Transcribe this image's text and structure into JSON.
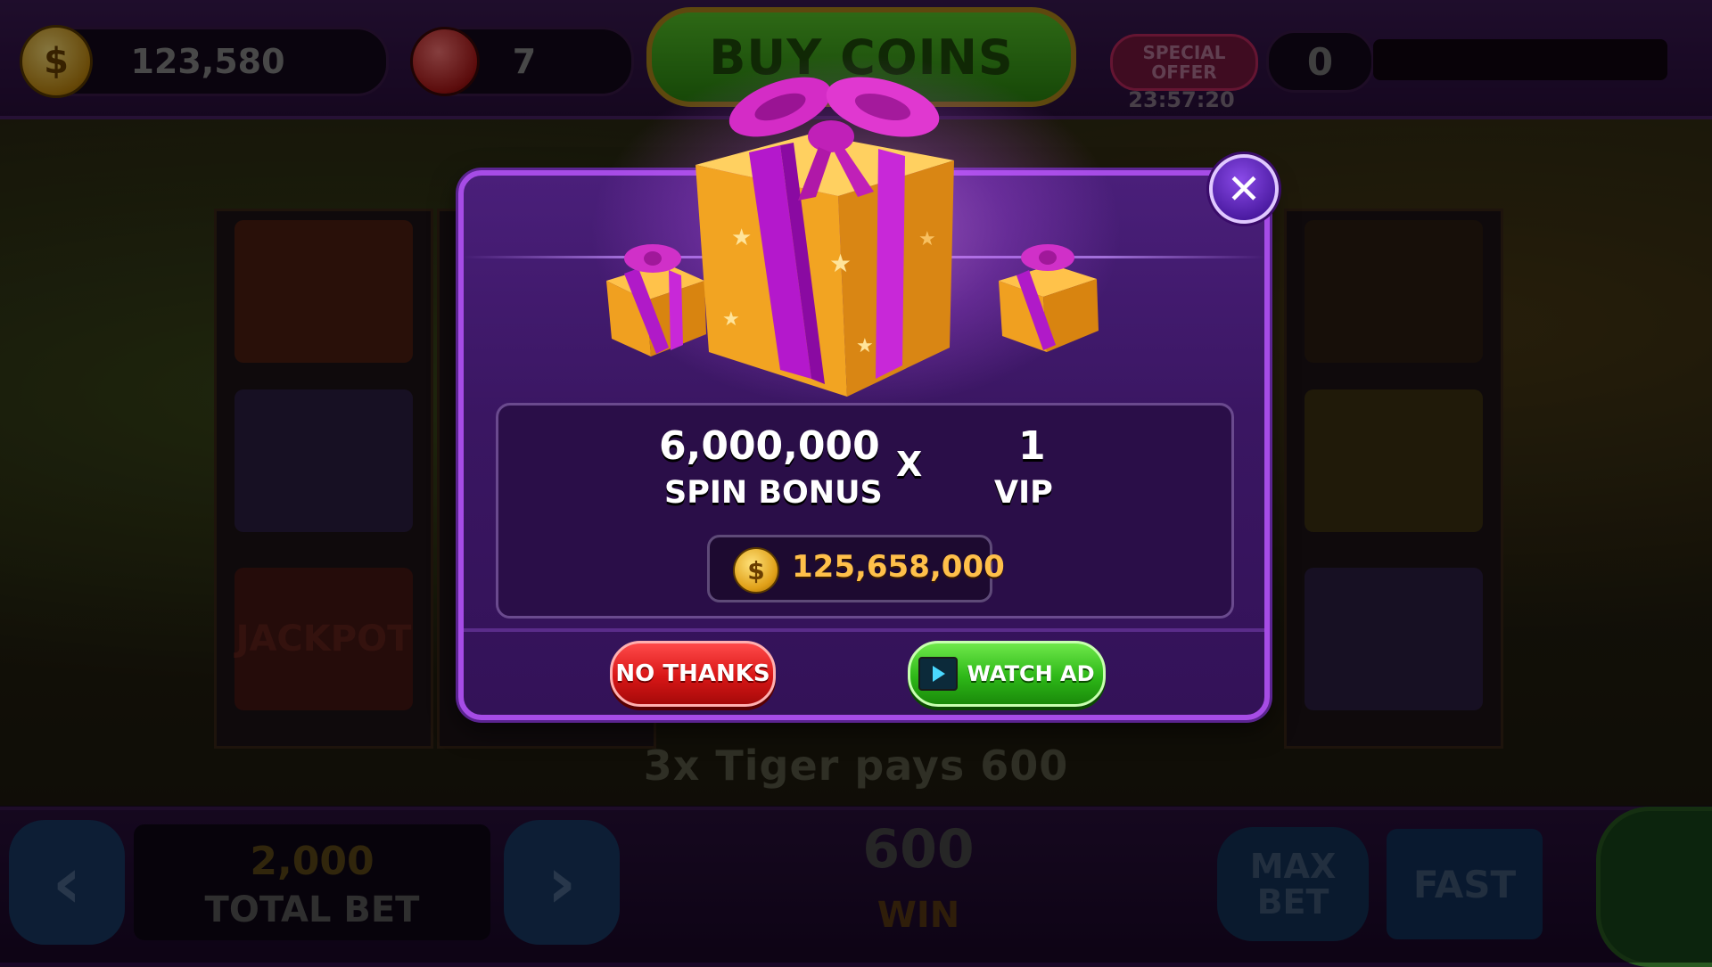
{
  "hud": {
    "coins": "123,580",
    "gems": "7",
    "buy_coins_label": "BUY COINS",
    "special_offer_label": "SPECIAL OFFER",
    "special_offer_timer": "23:57:20",
    "level": "0"
  },
  "game": {
    "pay_message": "3x Tiger pays 600",
    "total_bet_value": "2,000",
    "total_bet_label": "TOTAL BET",
    "win_value": "600",
    "win_label": "WIN",
    "max_bet_label": "MAX BET",
    "fast_label": "FAST",
    "jackpot_label": "JACKPOT"
  },
  "popup": {
    "spin_bonus_value": "6,000,000",
    "spin_bonus_label": "SPIN BONUS",
    "multiply_sign": "X",
    "vip_value": "1",
    "vip_label": "VIP",
    "coin_symbol": "$",
    "reward_total": "125,658,000",
    "no_thanks_label": "NO THANKS",
    "watch_ad_label": "WATCH AD",
    "close_symbol": "✕"
  },
  "icons": {
    "close": "close-icon",
    "coin": "coin-icon",
    "gem": "gem-icon",
    "video": "video-icon",
    "gift": "gift-box-icon"
  },
  "colors": {
    "popup_bg": "#3a1662",
    "popup_border": "#a64ce6",
    "reward_text": "#ffc04a",
    "no_thanks": "#d81616",
    "watch_ad": "#2eb818"
  }
}
